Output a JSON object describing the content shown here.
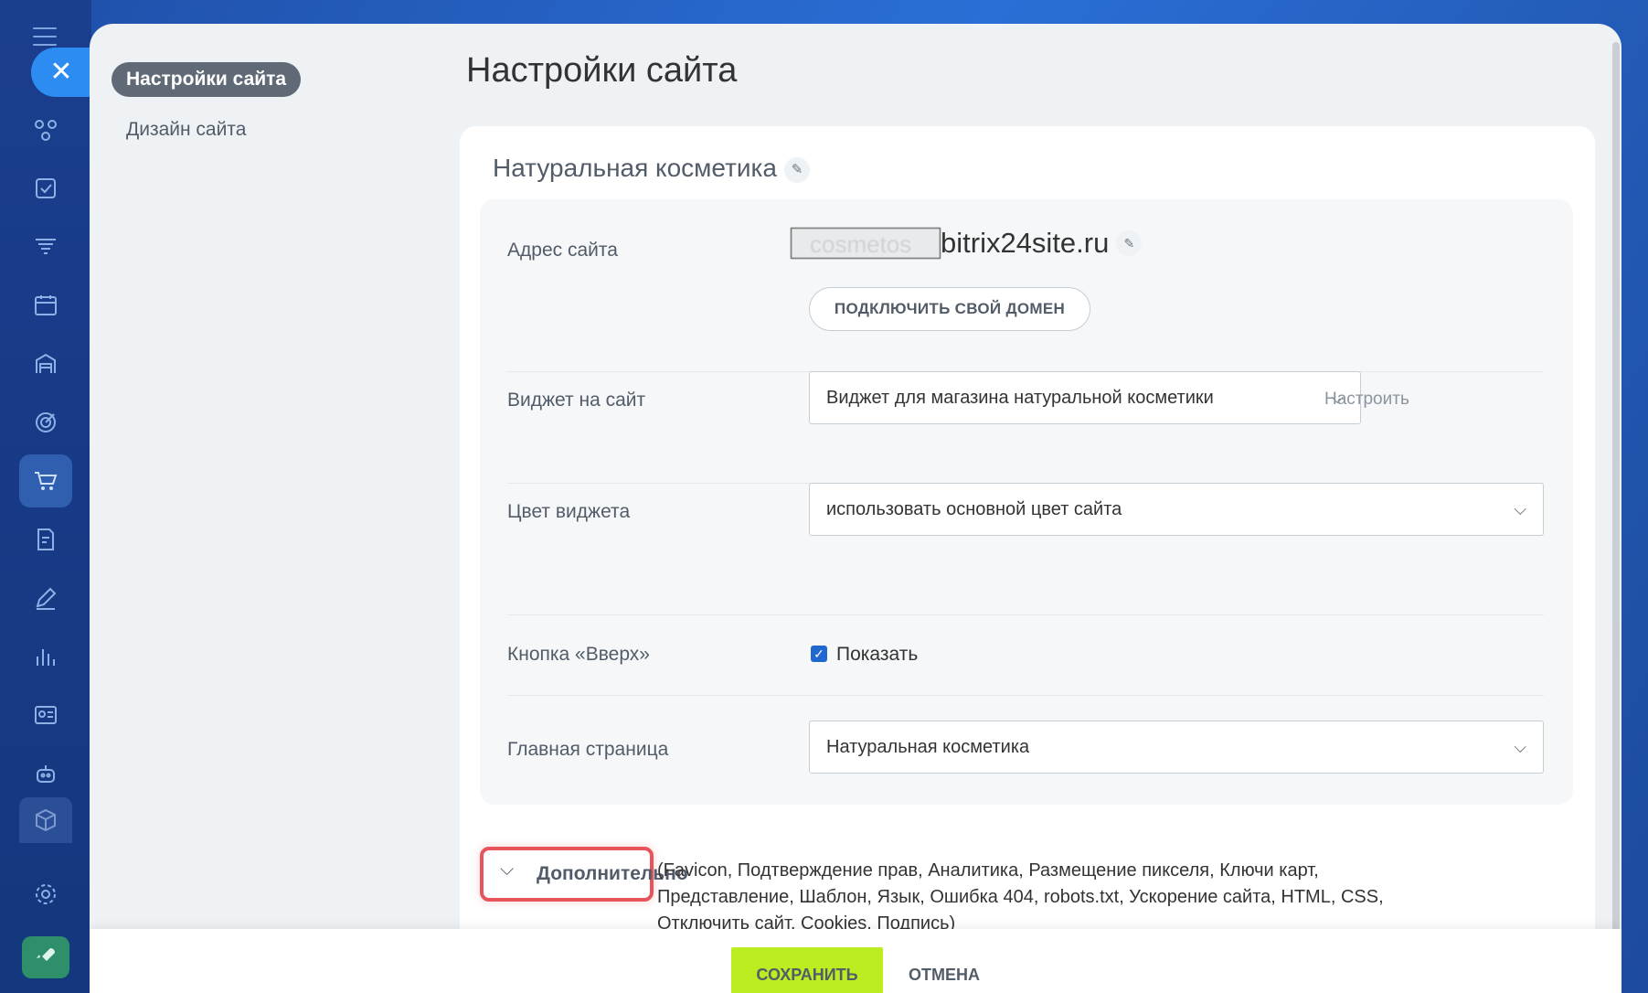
{
  "sidebar_nav": {
    "active": "Настройки сайта",
    "item": "Дизайн сайта"
  },
  "page": {
    "title": "Настройки сайта"
  },
  "card": {
    "title": "Натуральная косметика"
  },
  "address": {
    "label": "Адрес сайта",
    "prefix": "cosmetos",
    "domain": "bitrix24site.ru",
    "connect_button": "ПОДКЛЮЧИТЬ СВОЙ ДОМЕН"
  },
  "widget": {
    "label": "Виджет на сайт",
    "value": "Виджет для магазина натуральной косметики",
    "configure": "Настроить"
  },
  "widget_color": {
    "label": "Цвет виджета",
    "value": "использовать основной цвет сайта"
  },
  "up_button": {
    "label": "Кнопка «Вверх»",
    "checkbox_label": "Показать",
    "checked": true
  },
  "home_page": {
    "label": "Главная страница",
    "value": "Натуральная косметика"
  },
  "extra": {
    "label": "Дополнительно",
    "list_line1": "(Favicon,  Подтверждение прав,  Аналитика,  Размещение пикселя,  Ключи карт,",
    "list_line2": "Представление,  Шаблон,  Язык,  Ошибка 404,  robots.txt,  Ускорение сайта,  HTML,  CSS,",
    "list_line3": "Отключить сайт,  Cookies,  Подпись)"
  },
  "footer": {
    "save": "СОХРАНИТЬ",
    "cancel": "ОТМЕНА"
  },
  "colors": {
    "save_button": "#bbed21",
    "accent_blue": "#2067d0",
    "highlight_border": "#e8545c"
  }
}
